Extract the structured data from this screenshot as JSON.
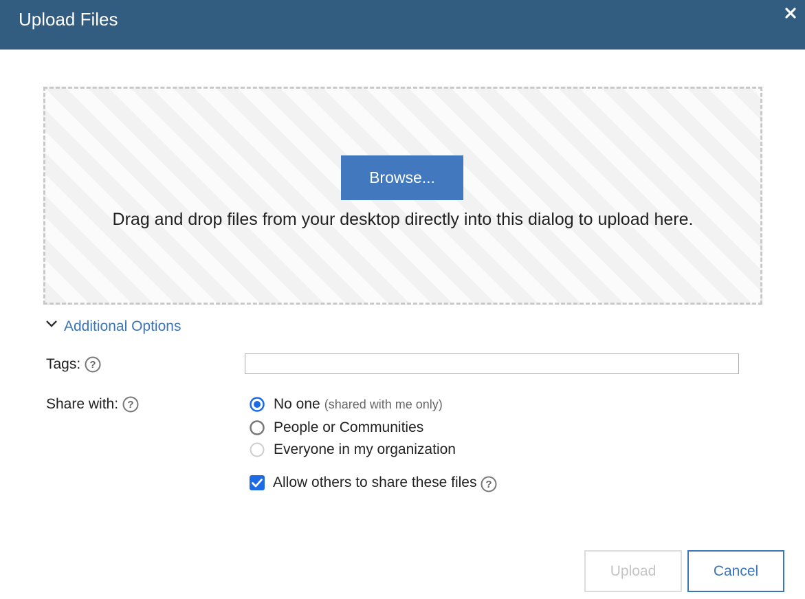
{
  "dialog": {
    "title": "Upload Files",
    "close_icon": "close-icon"
  },
  "dropzone": {
    "browse_label": "Browse...",
    "instructions": "Drag and drop files from your desktop directly into this dialog to upload here."
  },
  "additional_options": {
    "label": "Additional Options",
    "expanded": true,
    "icon": "chevron-down-icon"
  },
  "tags": {
    "label": "Tags:",
    "value": "",
    "placeholder": "",
    "help_icon": "help-icon"
  },
  "share": {
    "label": "Share with:",
    "help_icon": "help-icon",
    "options": [
      {
        "label": "No one",
        "hint": "(shared with me only)",
        "selected": true,
        "enabled": true
      },
      {
        "label": "People or Communities",
        "hint": "",
        "selected": false,
        "enabled": true
      },
      {
        "label": "Everyone in my organization",
        "hint": "",
        "selected": false,
        "enabled": false
      }
    ]
  },
  "allow_share": {
    "label": "Allow others to share these files",
    "checked": true,
    "help_icon": "help-icon"
  },
  "footer": {
    "upload_label": "Upload",
    "upload_enabled": false,
    "cancel_label": "Cancel"
  },
  "colors": {
    "titlebar": "#325c80",
    "accent": "#4178be",
    "link": "#3b74b8",
    "radio_selected": "#1d6ae5"
  }
}
